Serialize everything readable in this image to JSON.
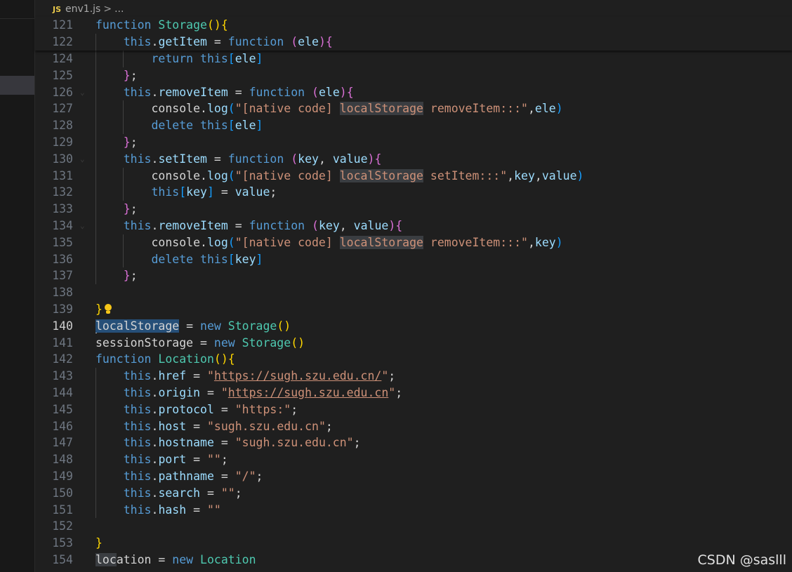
{
  "breadcrumb": {
    "file_icon": "JS",
    "file_name": "env1.js",
    "separator": ">",
    "ellipsis": "..."
  },
  "editor": {
    "current_line": "140",
    "sticky_lines": [
      {
        "num": "121",
        "code": "function Storage(){"
      },
      {
        "num": "122",
        "code": "    this.getItem = function (ele){"
      }
    ],
    "lines": [
      {
        "num": "124",
        "code": "        return this[ele]"
      },
      {
        "num": "125",
        "code": "    };"
      },
      {
        "num": "126",
        "code": "    this.removeItem = function (ele){"
      },
      {
        "num": "127",
        "code": "        console.log(\"[native code] localStorage removeItem:::\",ele)"
      },
      {
        "num": "128",
        "code": "        delete this[ele]"
      },
      {
        "num": "129",
        "code": "    };"
      },
      {
        "num": "130",
        "code": "    this.setItem = function (key, value){"
      },
      {
        "num": "131",
        "code": "        console.log(\"[native code] localStorage setItem:::\",key,value)"
      },
      {
        "num": "132",
        "code": "        this[key] = value;"
      },
      {
        "num": "133",
        "code": "    };"
      },
      {
        "num": "134",
        "code": "    this.removeItem = function (key, value){"
      },
      {
        "num": "135",
        "code": "        console.log(\"[native code] localStorage removeItem:::\",key)"
      },
      {
        "num": "136",
        "code": "        delete this[key]"
      },
      {
        "num": "137",
        "code": "    };"
      },
      {
        "num": "138",
        "code": ""
      },
      {
        "num": "139",
        "code": "}"
      },
      {
        "num": "140",
        "code": "localStorage = new Storage()"
      },
      {
        "num": "141",
        "code": "sessionStorage = new Storage()"
      },
      {
        "num": "142",
        "code": "function Location(){"
      },
      {
        "num": "143",
        "code": "    this.href = \"https://sugh.szu.edu.cn/\";"
      },
      {
        "num": "144",
        "code": "    this.origin = \"https://sugh.szu.edu.cn\";"
      },
      {
        "num": "145",
        "code": "    this.protocol = \"https:\";"
      },
      {
        "num": "146",
        "code": "    this.host = \"sugh.szu.edu.cn\";"
      },
      {
        "num": "147",
        "code": "    this.hostname = \"sugh.szu.edu.cn\";"
      },
      {
        "num": "148",
        "code": "    this.port = \"\";"
      },
      {
        "num": "149",
        "code": "    this.pathname = \"/\";"
      },
      {
        "num": "150",
        "code": "    this.search = \"\";"
      },
      {
        "num": "151",
        "code": "    this.hash = \"\""
      },
      {
        "num": "152",
        "code": ""
      },
      {
        "num": "153",
        "code": "}"
      },
      {
        "num": "154",
        "code": "location = new Location"
      }
    ]
  },
  "watermark": "CSDN @saslll",
  "icons": {
    "lightbulb": "lightbulb-icon",
    "file_type": "js-file-icon"
  },
  "colors": {
    "keyword": "#569cd6",
    "function_name": "#4ec9b0",
    "property": "#9cdcfe",
    "string": "#ce9178",
    "bracket_level1": "#ffd700",
    "bracket_level2": "#da70d6",
    "bracket_level3": "#179fff",
    "background": "#1f1f1f"
  }
}
